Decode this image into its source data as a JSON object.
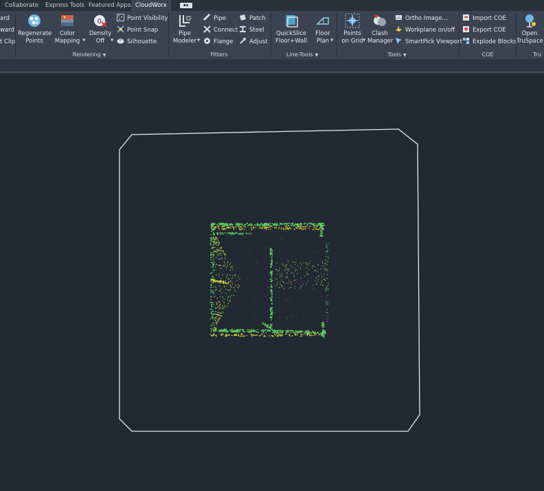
{
  "tabs": [
    {
      "label": "Collaborate"
    },
    {
      "label": "Express Tools"
    },
    {
      "label": "Featured Apps"
    },
    {
      "label": "CloudWorx"
    }
  ],
  "tab_extra": {
    "badge": "▪▪",
    "caret": "▾"
  },
  "ribbon": {
    "leftcut": {
      "items": [
        "ard",
        "ward",
        "t Clip"
      ]
    },
    "rendering": {
      "title": "Rendering",
      "regenerate": "Regenerate\nPoints",
      "color_mapping": "Color\nMapping",
      "density": "Density\nOff",
      "point_visibility": "Point Visibility",
      "point_snap": "Point Snap",
      "silhouette": "Silhouette"
    },
    "fitters": {
      "title": "Fitters",
      "pipe_modeler": "Pipe\nModeler",
      "pipe": "Pipe",
      "connect": "Connect",
      "flange": "Flange",
      "patch": "Patch",
      "steel": "Steel",
      "adjust": "Adjust"
    },
    "line_tools": {
      "title": "Line-Tools",
      "quickslice": "QuickSlice\nFloor+Wall",
      "floor_plan": "Floor\nPlan"
    },
    "tools": {
      "title": "Tools",
      "points_on_grid": "Points\non Grid",
      "clash_manager": "Clash\nManager",
      "ortho_image": "Ortho Image...",
      "workplane": "Workplane on/off",
      "smartpick": "SmartPick Viewport"
    },
    "coe": {
      "title": "COE",
      "import": "Import COE",
      "export": "Export COE",
      "explode": "Explode Blocks"
    },
    "truspace": {
      "title": "Tru",
      "open": "Open\nTruSpace"
    }
  },
  "colors": {
    "boundary": "#e8ebef",
    "cloud_green": "#5fd35f",
    "cloud_yellow": "#d7d23a",
    "background": "#222933"
  }
}
